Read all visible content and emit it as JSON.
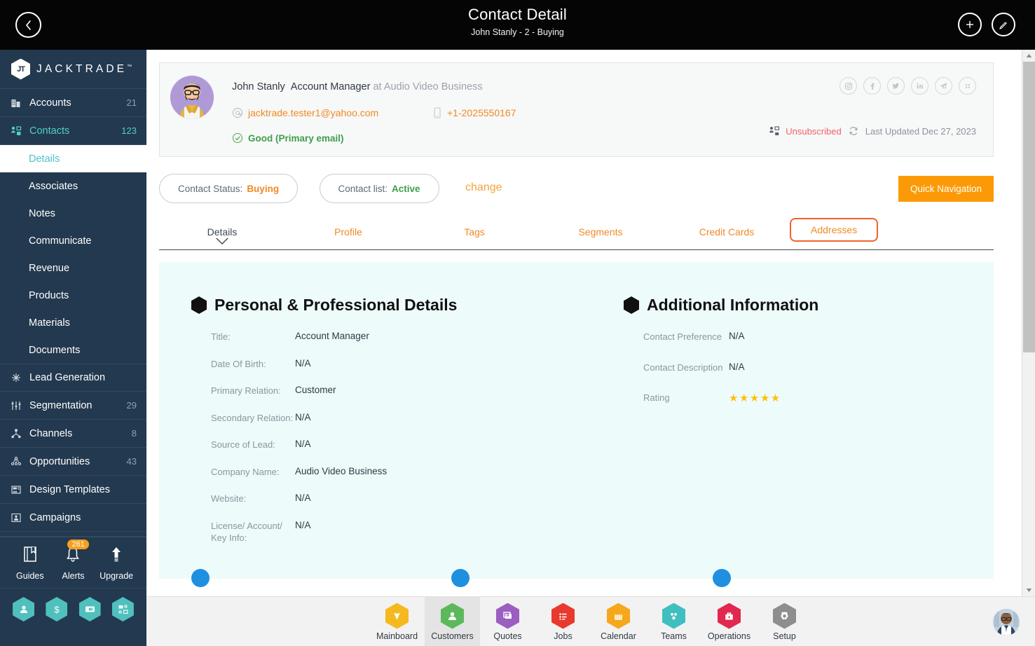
{
  "topbar": {
    "back_icon": "chevron-left-icon",
    "title": "Contact Detail",
    "subtitle": "John Stanly - 2 - Buying",
    "add_icon": "plus-icon",
    "edit_icon": "pencil-icon"
  },
  "sidebar": {
    "brand": {
      "mark": "JT",
      "name": "JACKTRADE",
      "tm": "™"
    },
    "items": [
      {
        "label": "Accounts",
        "count": "21",
        "icon": "building-icon",
        "active": false
      },
      {
        "label": "Contacts",
        "count": "123",
        "icon": "contacts-icon",
        "active": true
      }
    ],
    "sub_items": [
      {
        "label": "Details",
        "active": true
      },
      {
        "label": "Associates",
        "active": false
      },
      {
        "label": "Notes",
        "active": false
      },
      {
        "label": "Communicate",
        "active": false
      },
      {
        "label": "Revenue",
        "active": false
      },
      {
        "label": "Products",
        "active": false
      },
      {
        "label": "Materials",
        "active": false
      },
      {
        "label": "Documents",
        "active": false
      }
    ],
    "items2": [
      {
        "label": "Lead Generation",
        "count": "",
        "icon": "snowflake-icon"
      },
      {
        "label": "Segmentation",
        "count": "29",
        "icon": "segmentation-icon"
      },
      {
        "label": "Channels",
        "count": "8",
        "icon": "channels-icon"
      },
      {
        "label": "Opportunities",
        "count": "43",
        "icon": "opportunities-icon"
      },
      {
        "label": "Design Templates",
        "count": "",
        "icon": "design-templates-icon"
      },
      {
        "label": "Campaigns",
        "count": "",
        "icon": "campaigns-icon"
      }
    ],
    "utils": [
      {
        "label": "Guides",
        "icon": "book-icon",
        "badge": ""
      },
      {
        "label": "Alerts",
        "icon": "bell-icon",
        "badge": "261"
      },
      {
        "label": "Upgrade",
        "icon": "up-arrow-icon",
        "badge": ""
      }
    ],
    "quick_hexes": [
      {
        "icon": "person-icon"
      },
      {
        "icon": "dollar-icon"
      },
      {
        "icon": "money-transfer-icon"
      },
      {
        "icon": "workflow-icon"
      }
    ]
  },
  "contact": {
    "name": "John Stanly",
    "role": "Account Manager",
    "company_prefix": "at Audio Video Business",
    "email": "jacktrade.tester1@yahoo.com",
    "email_icon": "at-icon",
    "phone": "+1-2025550167",
    "phone_icon": "mobile-icon",
    "email_status": "Good (Primary email)",
    "email_status_icon": "check-circle-icon",
    "avatar_icon": "contact-avatar",
    "social": [
      {
        "icon": "instagram-icon"
      },
      {
        "icon": "facebook-icon"
      },
      {
        "icon": "twitter-icon"
      },
      {
        "icon": "linkedin-icon"
      },
      {
        "icon": "telegram-icon"
      },
      {
        "icon": "apps-grid-icon"
      }
    ],
    "subscription_status": "Unsubscribed",
    "subscription_icon": "unsubscribe-icon",
    "last_updated": "Last Updated Dec 27, 2023",
    "refresh_icon": "refresh-icon"
  },
  "status": {
    "contact_status_label": "Contact Status:",
    "contact_status_value": "Buying",
    "contact_list_label": "Contact list:",
    "contact_list_value": "Active",
    "change_link": "change",
    "quick_nav": "Quick Navigation"
  },
  "tabs": [
    {
      "label": "Details",
      "state": "active"
    },
    {
      "label": "Profile",
      "state": "normal"
    },
    {
      "label": "Tags",
      "state": "normal"
    },
    {
      "label": "Segments",
      "state": "normal"
    },
    {
      "label": "Credit Cards",
      "state": "normal"
    },
    {
      "label": "Addresses",
      "state": "highlight"
    }
  ],
  "personal": {
    "title": "Personal & Professional Details",
    "fields": [
      {
        "label": "Title:",
        "value": "Account Manager"
      },
      {
        "label": "Date Of Birth:",
        "value": "N/A"
      },
      {
        "label": "Primary Relation:",
        "value": "Customer"
      },
      {
        "label": "Secondary Relation:",
        "value": "N/A"
      },
      {
        "label": "Source of Lead:",
        "value": "N/A"
      },
      {
        "label": "Company Name:",
        "value": "Audio Video Business"
      },
      {
        "label": "Website:",
        "value": "N/A"
      },
      {
        "label": "License/ Account/ Key Info:",
        "value": "N/A"
      }
    ]
  },
  "additional": {
    "title": "Additional Information",
    "fields": [
      {
        "label": "Contact Preference",
        "value": "N/A"
      },
      {
        "label": "Contact Description",
        "value": "N/A"
      }
    ],
    "rating_label": "Rating",
    "rating_stars": "★★★★★",
    "rating_value": 5
  },
  "taskbar": {
    "items": [
      {
        "label": "Mainboard",
        "color": "#f5b91f",
        "icon": "mainboard-icon",
        "selected": false
      },
      {
        "label": "Customers",
        "color": "#5cb85c",
        "icon": "customers-icon",
        "selected": true
      },
      {
        "label": "Quotes",
        "color": "#9b5fc0",
        "icon": "quotes-icon",
        "selected": false
      },
      {
        "label": "Jobs",
        "color": "#e8392f",
        "icon": "jobs-icon",
        "selected": false
      },
      {
        "label": "Calendar",
        "color": "#f5a81c",
        "icon": "calendar-icon",
        "selected": false
      },
      {
        "label": "Teams",
        "color": "#3fbfbf",
        "icon": "teams-icon",
        "selected": false
      },
      {
        "label": "Operations",
        "color": "#e1284f",
        "icon": "operations-icon",
        "selected": false
      },
      {
        "label": "Setup",
        "color": "#8e8e8e",
        "icon": "setup-icon",
        "selected": false
      }
    ],
    "avatar_icon": "user-avatar"
  },
  "scrollbar": {
    "up_icon": "scroll-up-icon",
    "down_icon": "scroll-down-icon"
  },
  "colors": {
    "accent_orange": "#f08a24",
    "brand_dark": "#23394f",
    "teal": "#4fc0bd",
    "highlight": "#f2622a",
    "panel_bg": "#eefbfb"
  }
}
